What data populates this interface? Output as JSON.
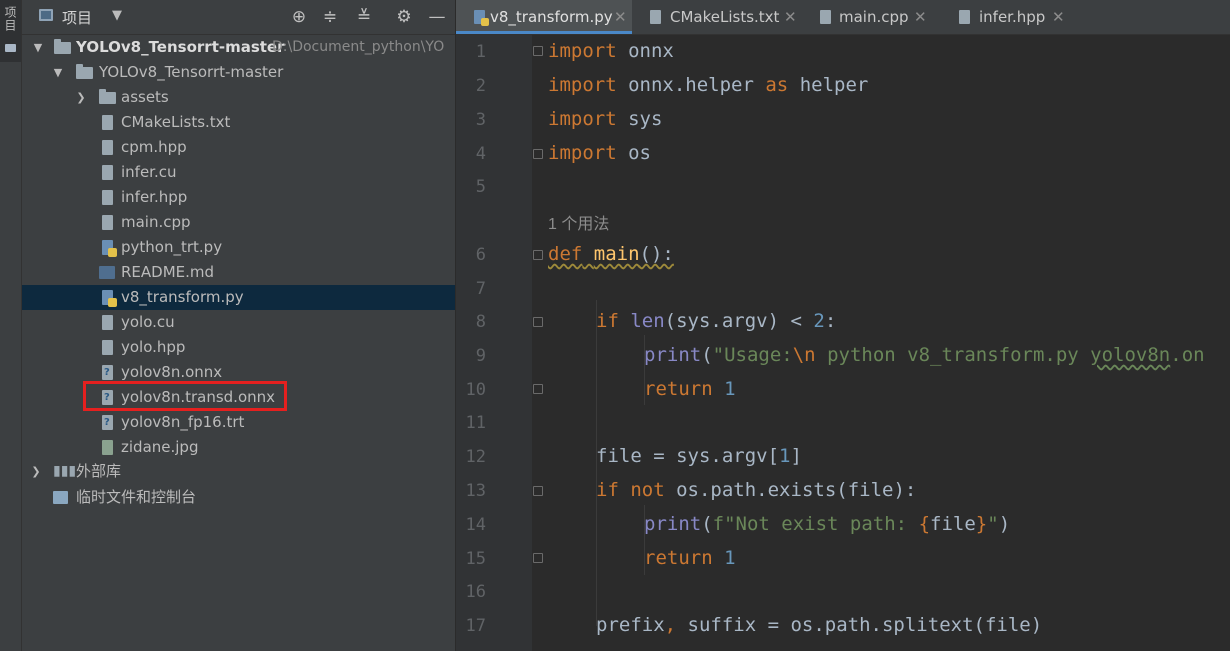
{
  "sidebar_strip": {
    "label": "项目"
  },
  "project_panel": {
    "title": "项目",
    "tree": {
      "root_name": "YOLOv8_Tensorrt-master",
      "root_path": "D:\\Document_python\\YO",
      "subfolder": "YOLOv8_Tensorrt-master",
      "assets": "assets",
      "files": [
        {
          "name": "CMakeLists.txt"
        },
        {
          "name": "cpm.hpp"
        },
        {
          "name": "infer.cu"
        },
        {
          "name": "infer.hpp"
        },
        {
          "name": "main.cpp"
        },
        {
          "name": "python_trt.py"
        },
        {
          "name": "README.md"
        },
        {
          "name": "v8_transform.py"
        },
        {
          "name": "yolo.cu"
        },
        {
          "name": "yolo.hpp"
        },
        {
          "name": "yolov8n.onnx"
        },
        {
          "name": "yolov8n.transd.onnx"
        },
        {
          "name": "yolov8n_fp16.trt"
        },
        {
          "name": "zidane.jpg"
        }
      ],
      "external_libs": "外部库",
      "scratches": "临时文件和控制台"
    }
  },
  "editor": {
    "tabs": [
      {
        "label": "v8_transform.py",
        "active": true
      },
      {
        "label": "CMakeLists.txt",
        "active": false
      },
      {
        "label": "main.cpp",
        "active": false
      },
      {
        "label": "infer.hpp",
        "active": false
      }
    ],
    "usage_hint": "1 个用法",
    "line_numbers": [
      "1",
      "2",
      "3",
      "4",
      "5",
      "6",
      "7",
      "8",
      "9",
      "10",
      "11",
      "12",
      "13",
      "14",
      "15",
      "16",
      "17"
    ],
    "code": {
      "l1": [
        "import",
        " onnx"
      ],
      "l2": [
        "import",
        " onnx.helper ",
        "as",
        " helper"
      ],
      "l3": [
        "import",
        " sys"
      ],
      "l4": [
        "import",
        " os"
      ],
      "l6": [
        "def",
        " ",
        "main",
        "():"
      ],
      "l8": [
        "if",
        " ",
        "len",
        "(sys.argv) < ",
        "2",
        ":"
      ],
      "l9": [
        "print",
        "(",
        "\"Usage:",
        "\\n",
        " python v8_transform.py ",
        "yolov8n",
        ".on"
      ],
      "l10": [
        "return",
        " ",
        "1"
      ],
      "l12": [
        "file = sys.argv[",
        "1",
        "]"
      ],
      "l13": [
        "if",
        " ",
        "not",
        " os.path.exists(file):"
      ],
      "l14": [
        "print",
        "(",
        "f\"Not exist path: ",
        "{",
        "file",
        "}",
        "\"",
        ")"
      ],
      "l15": [
        "return",
        " ",
        "1"
      ],
      "l17": [
        "prefix",
        ",",
        " suffix = os.path.splitext(file)"
      ]
    }
  }
}
